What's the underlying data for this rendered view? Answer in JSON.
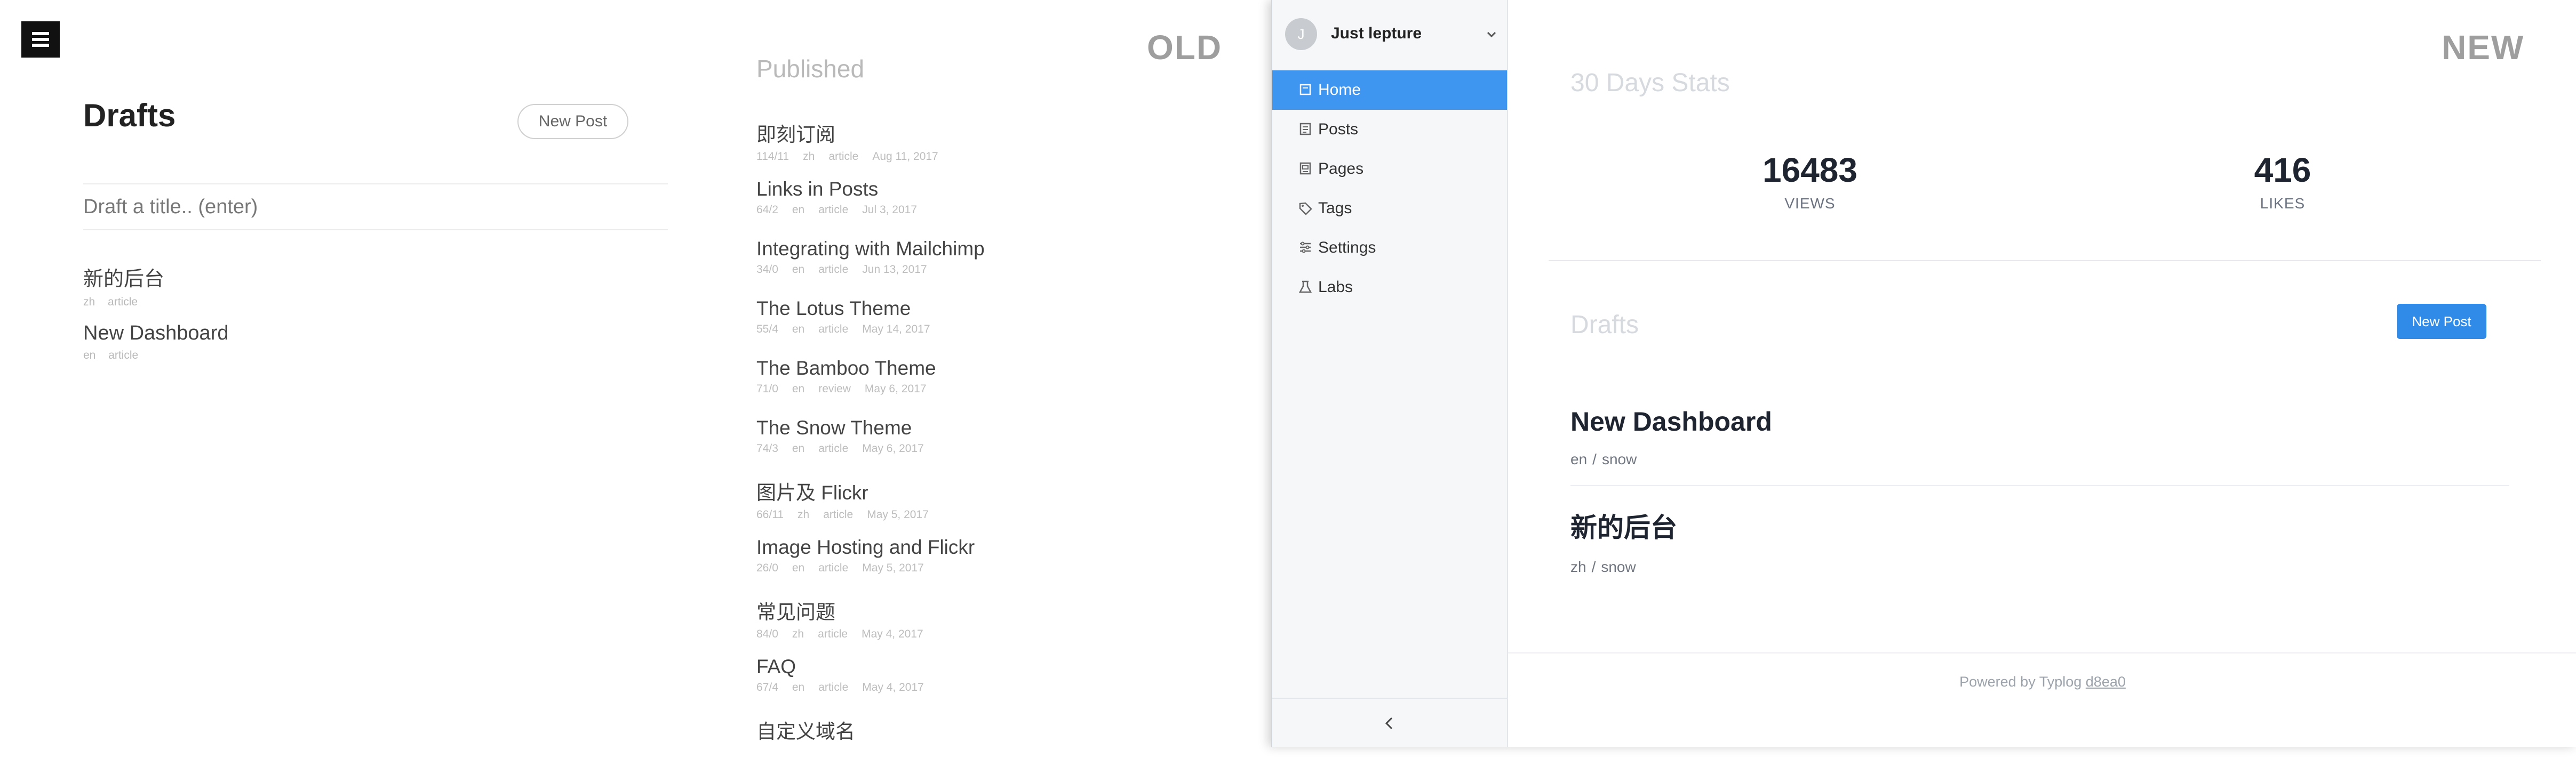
{
  "old": {
    "label": "OLD",
    "drafts_title": "Drafts",
    "new_post": "New Post",
    "draft_placeholder": "Draft a title.. (enter)",
    "drafts": [
      {
        "title": "新的后台",
        "lang": "zh",
        "type": "article"
      },
      {
        "title": "New Dashboard",
        "lang": "en",
        "type": "article"
      }
    ],
    "published_title": "Published",
    "published": [
      {
        "title": "即刻订阅",
        "count": "114/11",
        "lang": "zh",
        "type": "article",
        "date": "Aug 11, 2017"
      },
      {
        "title": "Links in Posts",
        "count": "64/2",
        "lang": "en",
        "type": "article",
        "date": "Jul 3, 2017"
      },
      {
        "title": "Integrating with Mailchimp",
        "count": "34/0",
        "lang": "en",
        "type": "article",
        "date": "Jun 13, 2017"
      },
      {
        "title": "The Lotus Theme",
        "count": "55/4",
        "lang": "en",
        "type": "article",
        "date": "May 14, 2017"
      },
      {
        "title": "The Bamboo Theme",
        "count": "71/0",
        "lang": "en",
        "type": "review",
        "date": "May 6, 2017"
      },
      {
        "title": "The Snow Theme",
        "count": "74/3",
        "lang": "en",
        "type": "article",
        "date": "May 6, 2017"
      },
      {
        "title": "图片及 Flickr",
        "count": "66/11",
        "lang": "zh",
        "type": "article",
        "date": "May 5, 2017"
      },
      {
        "title": "Image Hosting and Flickr",
        "count": "26/0",
        "lang": "en",
        "type": "article",
        "date": "May 5, 2017"
      },
      {
        "title": "常见问题",
        "count": "84/0",
        "lang": "zh",
        "type": "article",
        "date": "May 4, 2017"
      },
      {
        "title": "FAQ",
        "count": "67/4",
        "lang": "en",
        "type": "article",
        "date": "May 4, 2017"
      },
      {
        "title": "自定义域名",
        "count": "",
        "lang": "",
        "type": "",
        "date": ""
      }
    ]
  },
  "new": {
    "label": "NEW",
    "user": {
      "initial": "J",
      "name": "Just lepture"
    },
    "nav": [
      {
        "label": "Home",
        "icon": "home-icon",
        "active": true
      },
      {
        "label": "Posts",
        "icon": "posts-icon",
        "active": false
      },
      {
        "label": "Pages",
        "icon": "pages-icon",
        "active": false
      },
      {
        "label": "Tags",
        "icon": "tag-icon",
        "active": false
      },
      {
        "label": "Settings",
        "icon": "settings-icon",
        "active": false
      },
      {
        "label": "Labs",
        "icon": "flask-icon",
        "active": false
      }
    ],
    "collapse_icon": "chevron-left-icon",
    "stats_title": "30 Days Stats",
    "stats": [
      {
        "value": "16483",
        "label": "VIEWS"
      },
      {
        "value": "416",
        "label": "LIKES"
      }
    ],
    "drafts_title": "Drafts",
    "new_post": "New Post",
    "drafts": [
      {
        "title": "New Dashboard",
        "lang": "en",
        "theme": "snow"
      },
      {
        "title": "新的后台",
        "lang": "zh",
        "theme": "snow"
      }
    ],
    "footer_text": "Powered by Typlog",
    "footer_link": "d8ea0"
  },
  "colors": {
    "accent": "#3f96f0",
    "button": "#2f8ae8",
    "tag": "#9e9e9e"
  }
}
